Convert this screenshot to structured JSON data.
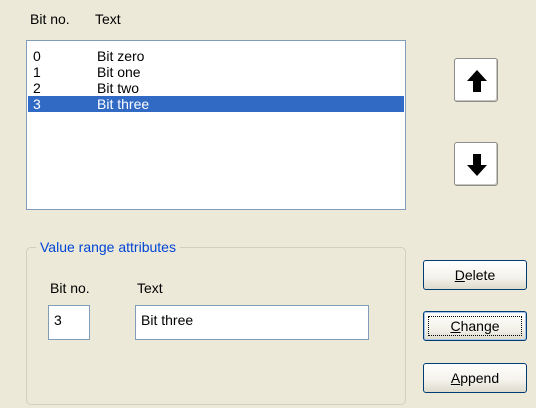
{
  "list": {
    "headers": [
      "Bit no.",
      "Text"
    ],
    "rows": [
      {
        "bit": "0",
        "text": "Bit zero"
      },
      {
        "bit": "1",
        "text": "Bit one"
      },
      {
        "bit": "2",
        "text": "Bit two"
      },
      {
        "bit": "3",
        "text": "Bit three"
      }
    ],
    "selected_index": 3
  },
  "move_buttons": {
    "up_icon": "arrow-up-icon",
    "down_icon": "arrow-down-icon"
  },
  "value_range": {
    "title": "Value range attributes",
    "bit_label": "Bit no.",
    "text_label": "Text",
    "bit_value": "3",
    "text_value": "Bit three"
  },
  "buttons": {
    "delete": {
      "mnemonic": "D",
      "rest": "elete"
    },
    "change": {
      "mnemonic": "C",
      "rest": "hange"
    },
    "append": {
      "mnemonic": "A",
      "rest": "ppend"
    }
  },
  "colors": {
    "dialog_bg": "#ece9d8",
    "selection": "#316ac5",
    "group_title": "#0046d5"
  }
}
